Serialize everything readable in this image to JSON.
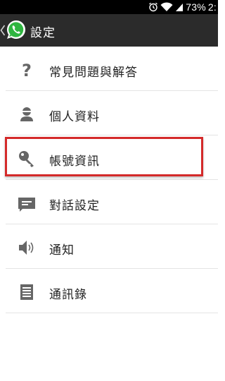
{
  "status_bar": {
    "battery_percent": "73%",
    "time_partial": "2:",
    "icons": [
      "alarm-icon",
      "wifi-icon",
      "signal-icon"
    ]
  },
  "action_bar": {
    "title": "設定",
    "logo": "whatsapp-logo-icon",
    "background": "#2b2b2b"
  },
  "settings": {
    "items": [
      {
        "label": "常見問題與解答",
        "icon": "help-icon"
      },
      {
        "label": "個人資料",
        "icon": "profile-icon"
      },
      {
        "label": "帳號資訊",
        "icon": "key-icon"
      },
      {
        "label": "對話設定",
        "icon": "chat-icon"
      },
      {
        "label": "通知",
        "icon": "speaker-icon"
      },
      {
        "label": "通訊錄",
        "icon": "contacts-icon"
      }
    ]
  },
  "annotation": {
    "highlight_color": "#d42a2a",
    "highlighted_item": "帳號資訊"
  }
}
